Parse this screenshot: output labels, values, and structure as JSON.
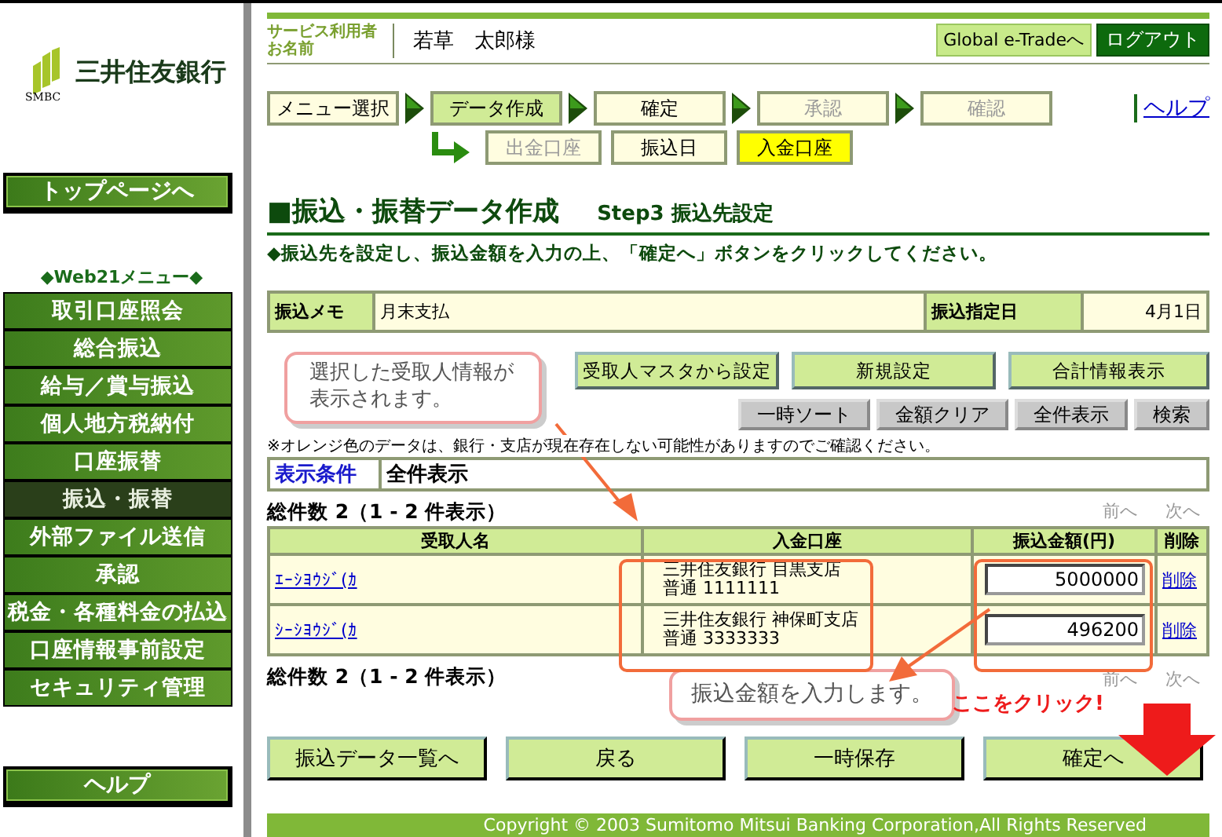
{
  "logo": {
    "name": "三井住友銀行",
    "mark": "SMBC"
  },
  "sidebar": {
    "top_button": "トップページへ",
    "menu_title": "◆Web21メニュー◆",
    "help_button": "ヘルプ",
    "items": [
      {
        "label": "取引口座照会",
        "selected": false
      },
      {
        "label": "総合振込",
        "selected": false
      },
      {
        "label": "給与／賞与振込",
        "selected": false
      },
      {
        "label": "個人地方税納付",
        "selected": false
      },
      {
        "label": "口座振替",
        "selected": false
      },
      {
        "label": "振込・振替",
        "selected": true
      },
      {
        "label": "外部ファイル送信",
        "selected": false
      },
      {
        "label": "承認",
        "selected": false
      },
      {
        "label": "税金・各種料金の払込",
        "selected": false
      },
      {
        "label": "口座情報事前設定",
        "selected": false
      },
      {
        "label": "セキュリティ管理",
        "selected": false
      }
    ]
  },
  "header": {
    "user_label": [
      "サービス利用者",
      "お名前"
    ],
    "user_name": "若草　太郎様",
    "global_link": "Global e-Tradeへ",
    "logout": "ログアウト"
  },
  "steps": [
    {
      "label": "メニュー選択",
      "selected": false,
      "disabled": false
    },
    {
      "label": "データ作成",
      "selected": true,
      "disabled": false
    },
    {
      "label": "確定",
      "selected": false,
      "disabled": false
    },
    {
      "label": "承認",
      "selected": false,
      "disabled": true
    },
    {
      "label": "確認",
      "selected": false,
      "disabled": true
    }
  ],
  "substeps": [
    {
      "label": "出金口座",
      "selected": false,
      "disabled": true
    },
    {
      "label": "振込日",
      "selected": false,
      "disabled": false
    },
    {
      "label": "入金口座",
      "selected": true,
      "disabled": false
    }
  ],
  "help_link": "ヘルプ",
  "title": "■振込・振替データ作成",
  "subtitle": "Step3 振込先設定",
  "instruction": "◆振込先を設定し、振込金額を入力の上、「確定へ」ボタンをクリックしてください。",
  "memo": {
    "label": "振込メモ",
    "value": "月末支払",
    "date_label": "振込指定日",
    "date_value": "4月1日"
  },
  "primary_buttons": [
    "受取人マスタから設定",
    "新規設定",
    "合計情報表示"
  ],
  "secondary_buttons": [
    "一時ソート",
    "金額クリア",
    "全件表示",
    "検索"
  ],
  "note": "※オレンジ色のデータは、銀行・支店が現在存在しない可能性がありますのでご確認ください。",
  "filter": {
    "label": "表示条件",
    "value": "全件表示"
  },
  "count_top": "総件数 2（1 - 2 件表示）",
  "count_bottom": "総件数 2（1 - 2 件表示）",
  "pager_top": [
    {
      "label": "前へ",
      "disabled": true
    },
    {
      "label": "次へ",
      "disabled": true
    }
  ],
  "pager_bottom": [
    {
      "label": "前へ",
      "disabled": true
    },
    {
      "label": "次へ",
      "disabled": true
    }
  ],
  "table": {
    "columns": [
      "受取人名",
      "入金口座",
      "振込金額(円)",
      "削除"
    ],
    "rows": [
      {
        "name": "ｴｰｼﾖｳｼﾞ(ｶ",
        "bank": "三井住友銀行 目黒支店",
        "account": "普通 1111111",
        "amount": "5000000",
        "delete": "削除"
      },
      {
        "name": "ｼｰｼﾖｳｼﾞ(ｶ",
        "bank": "三井住友銀行 神保町支店",
        "account": "普通 3333333",
        "amount": "496200",
        "delete": "削除"
      }
    ]
  },
  "callouts": {
    "recipient": "選択した受取人情報が表示されます。",
    "amount": "振込金額を入力します。",
    "click": "ここをクリック!"
  },
  "bottom_buttons": [
    "振込データ一覧へ",
    "戻る",
    "一時保存",
    "確定へ"
  ],
  "copyright": "Copyright © 2003 Sumitomo Mitsui Banking Corporation,All Rights Reserved"
}
